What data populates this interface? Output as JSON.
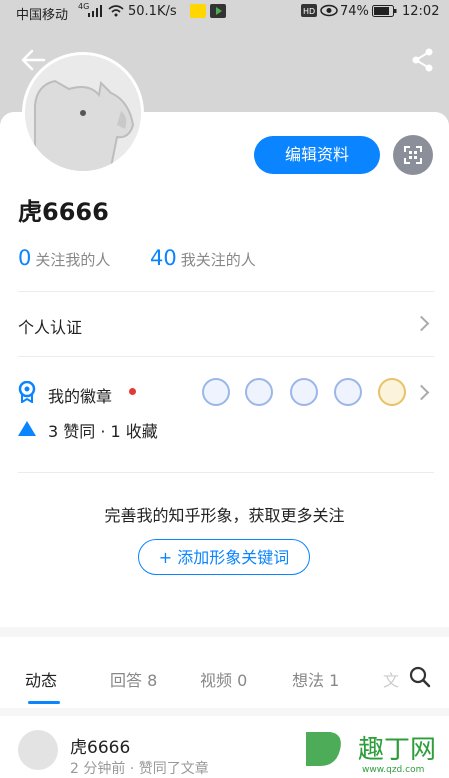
{
  "status_bar": {
    "carrier": "中国移动",
    "net": "4G",
    "speed": "50.1K/s",
    "battery": "74%",
    "time": "12:02"
  },
  "header": {
    "back": "back-arrow-icon",
    "share": "share-icon"
  },
  "profile": {
    "edit_label": "编辑资料",
    "name": "虎6666",
    "followers_count": "0",
    "followers_label": "关注我的人",
    "following_count": "40",
    "following_label": "我关注的人"
  },
  "rows": {
    "cert_label": "个人认证",
    "badge_label": "我的徽章",
    "stats_label": "3 赞同 · 1 收藏"
  },
  "cta": {
    "text": "完善我的知乎形象，获取更多关注",
    "button": "+ 添加形象关键词"
  },
  "tabs": [
    "动态",
    "回答 8",
    "视频 0",
    "想法 1",
    "文"
  ],
  "feed": {
    "name": "虎6666",
    "sub": "2 分钟前 · 赞同了文章"
  },
  "watermark": {
    "text": "趣丁网",
    "url": "www.qzd.com"
  },
  "colors": {
    "accent": "#0a84ff",
    "badge_dot": "#e53935"
  }
}
